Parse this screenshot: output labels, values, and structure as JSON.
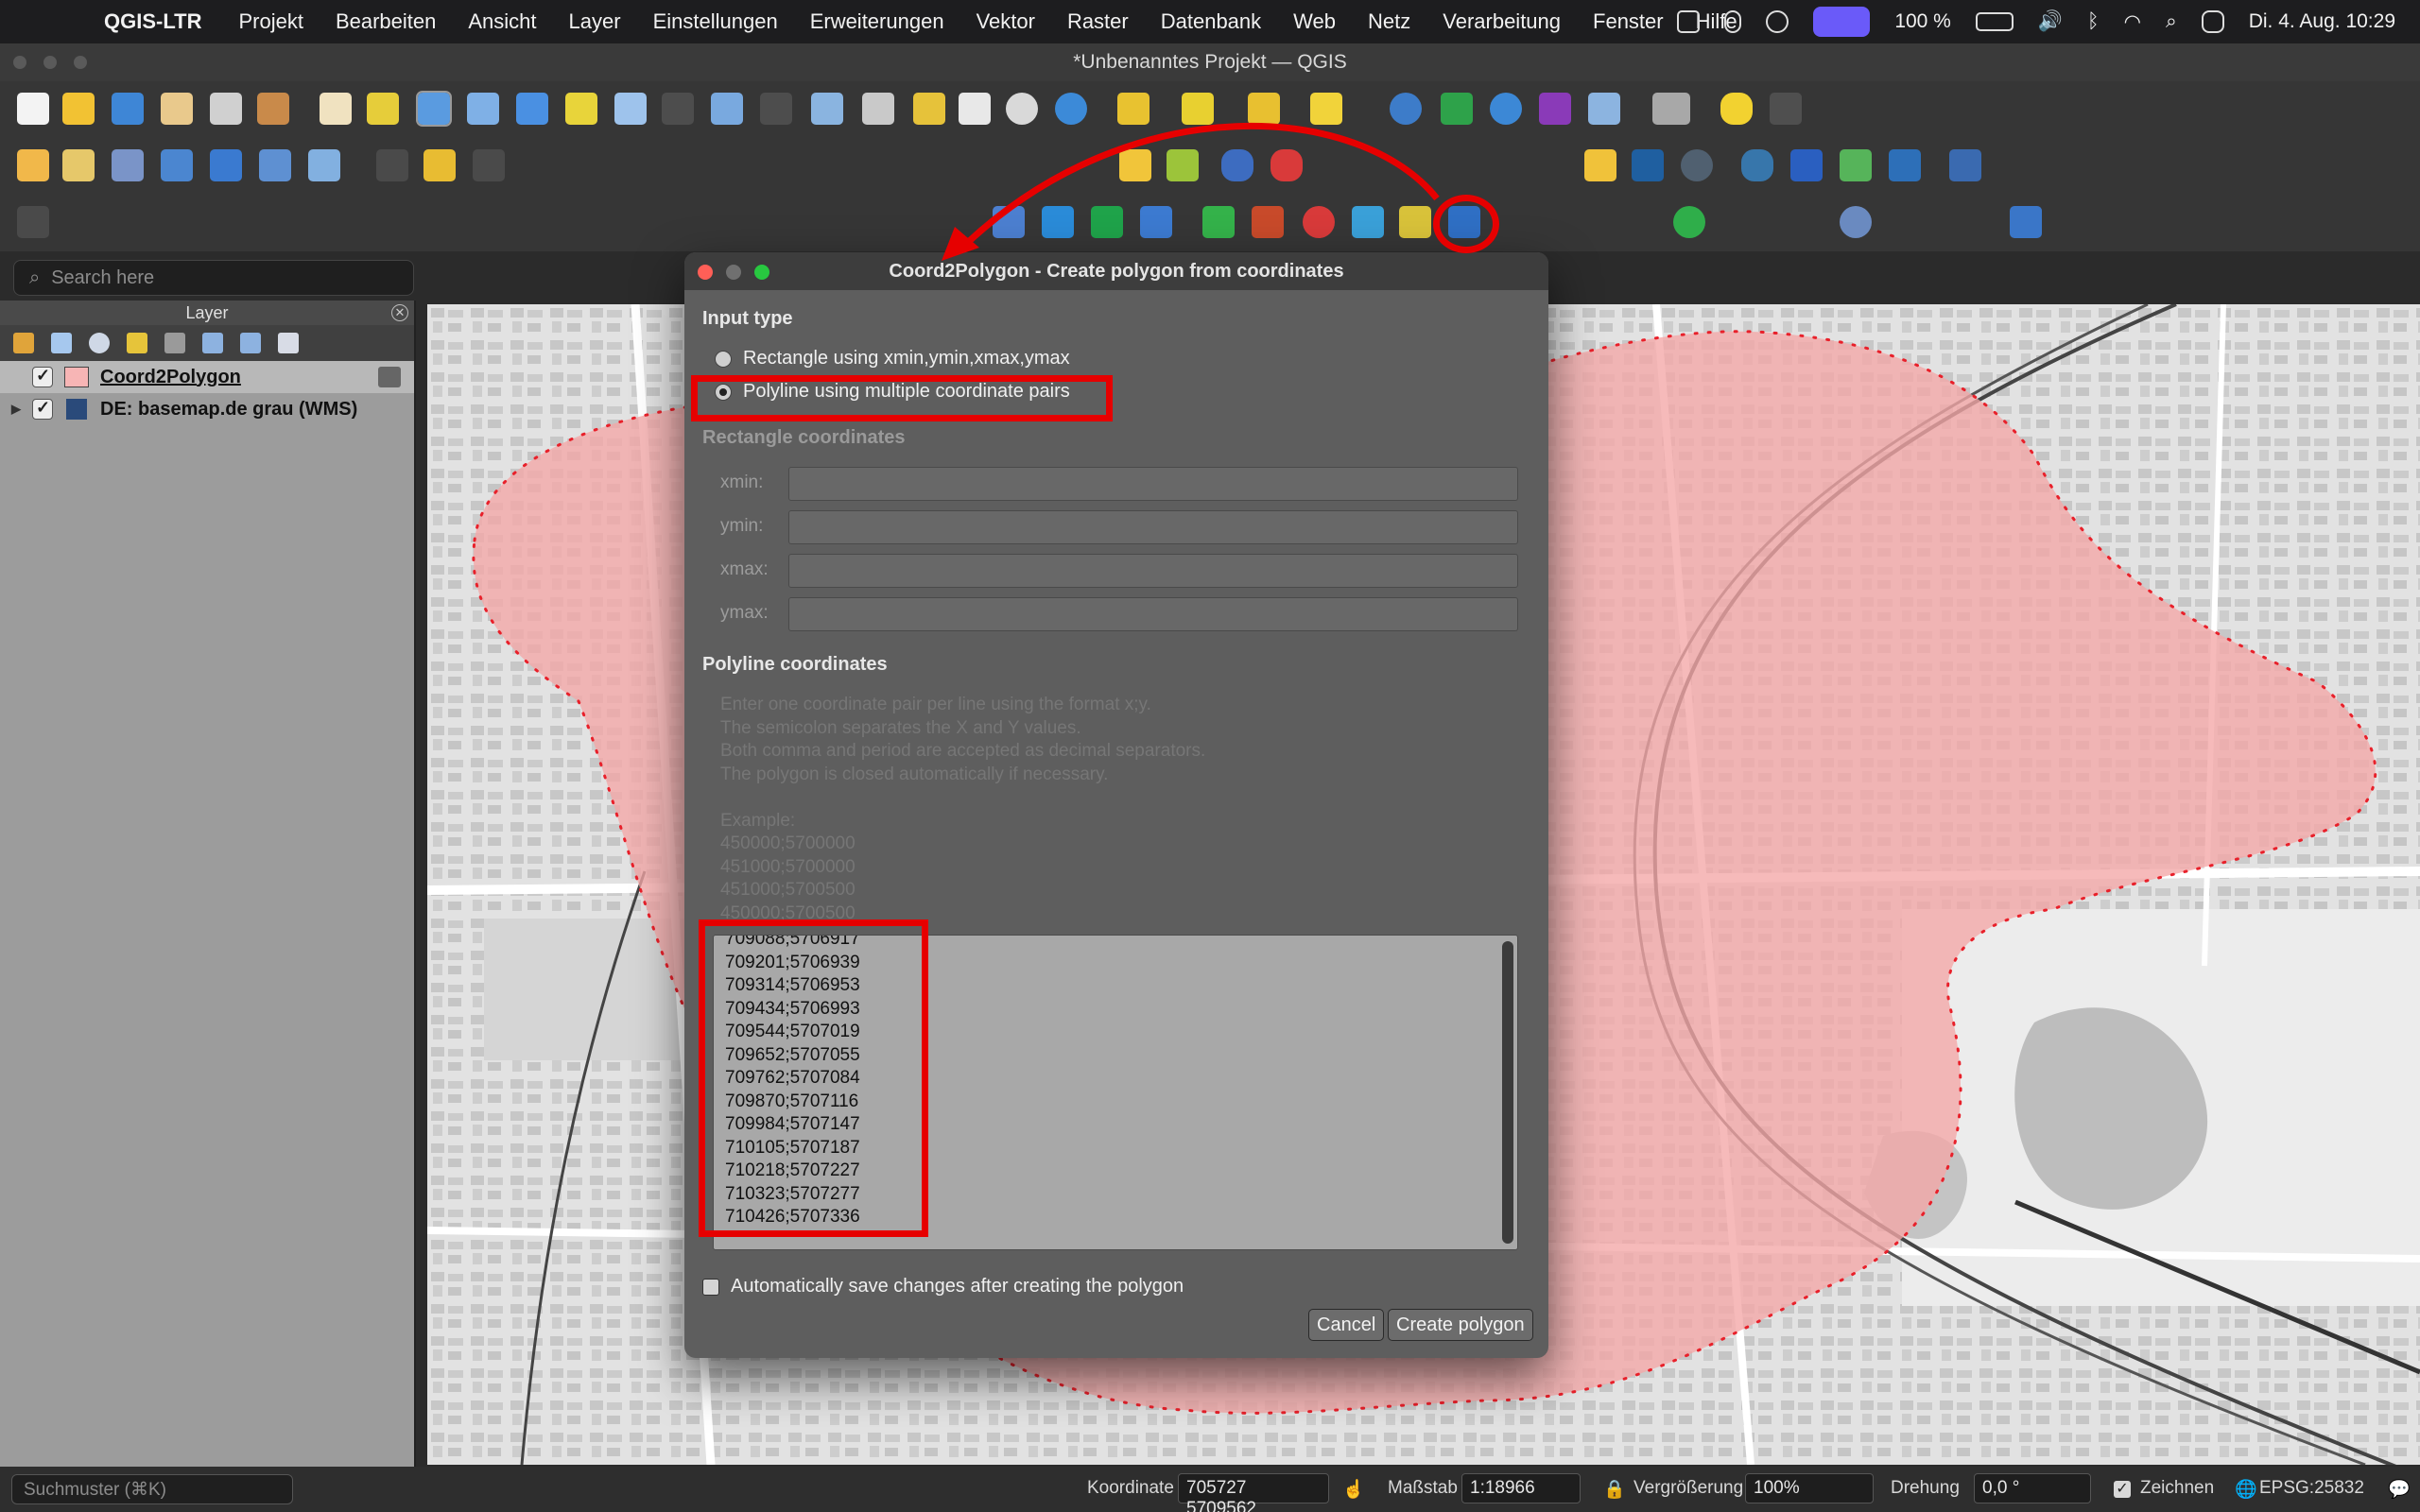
{
  "menubar": {
    "app_name": "QGIS-LTR",
    "items": [
      "Projekt",
      "Bearbeiten",
      "Ansicht",
      "Layer",
      "Einstellungen",
      "Erweiterungen",
      "Vektor",
      "Raster",
      "Datenbank",
      "Web",
      "Netz",
      "Verarbeitung",
      "Fenster",
      "Hilfe"
    ],
    "battery": "100 %",
    "datetime": "Di. 4. Aug.  10:29"
  },
  "window": {
    "title": "*Unbenanntes Projekt — QGIS"
  },
  "left_panel": {
    "search_placeholder": "Search here",
    "layer_panel_title": "Layer",
    "layers": [
      {
        "name": "Coord2Polygon",
        "checked": true,
        "color": "#f7b5b5"
      },
      {
        "name": "DE: basemap.de grau (WMS)",
        "checked": true
      }
    ]
  },
  "dialog": {
    "title": "Coord2Polygon - Create polygon from coordinates",
    "input_type_label": "Input type",
    "radio_rectangle": "Rectangle using xmin,ymin,xmax,ymax",
    "radio_polyline": "Polyline using multiple coordinate pairs",
    "selected_input_type": "polyline",
    "rectangle_section": "Rectangle coordinates",
    "fields": {
      "xmin": "xmin:",
      "ymin": "ymin:",
      "xmax": "xmax:",
      "ymax": "ymax:"
    },
    "polyline_section": "Polyline coordinates",
    "help_lines": [
      "Enter one coordinate pair per line using the format x;y.",
      "The semicolon separates the X and Y values.",
      "Both comma and period are accepted as decimal separators.",
      "The polygon is closed automatically if necessary.",
      "",
      "Example:",
      "450000;5700000",
      "451000;5700000",
      "451000;5700500",
      "450000;5700500"
    ],
    "coordinates": [
      "709088;5706917",
      "709201;5706939",
      "709314;5706953",
      "709434;5706993",
      "709544;5707019",
      "709652;5707055",
      "709762;5707084",
      "709870;5707116",
      "709984;5707147",
      "710105;5707187",
      "710218;5707227",
      "710323;5707277",
      "710426;5707336"
    ],
    "autosave_label": "Automatically save changes after creating the polygon",
    "autosave_checked": false,
    "cancel_label": "Cancel",
    "create_label": "Create polygon"
  },
  "statusbar": {
    "locator_placeholder": "Suchmuster (⌘K)",
    "coord_label": "Koordinate",
    "coord_value": "705727  5709562",
    "scale_label": "Maßstab",
    "scale_value": "1:18966",
    "magnifier_label": "Vergrößerung",
    "magnifier_value": "100%",
    "rotation_label": "Drehung",
    "rotation_value": "0,0 °",
    "render_label": "Zeichnen",
    "render_checked": true,
    "crs": "EPSG:25832"
  },
  "colors": {
    "highlight": "#e60000",
    "polygon_fill": "#f4a6a6",
    "polygon_outline": "#e8202a"
  }
}
